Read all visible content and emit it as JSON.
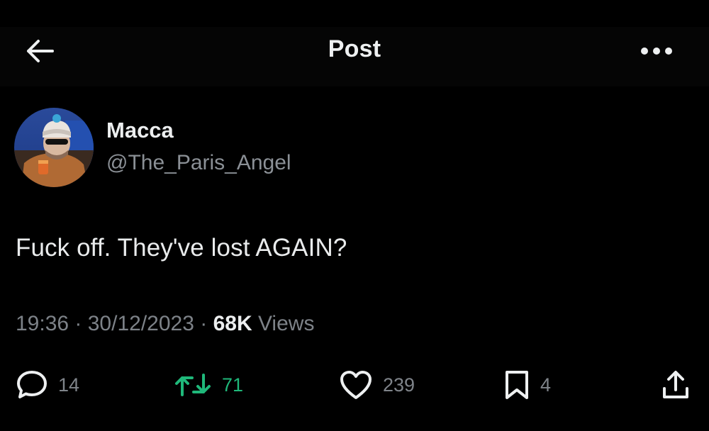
{
  "header": {
    "title": "Post"
  },
  "author": {
    "display_name": "Macca",
    "handle": "@The_Paris_Angel"
  },
  "post": {
    "text": "Fuck off.  They've lost AGAIN?",
    "time": "19:36",
    "date": "30/12/2023",
    "views_count": "68K",
    "views_label": "Views"
  },
  "actions": {
    "replies": "14",
    "reposts": "71",
    "likes": "239",
    "bookmarks": "4"
  },
  "colors": {
    "background": "#000000",
    "repost_active": "#1fb87a",
    "muted_text": "#7d8288"
  },
  "icons": {
    "back": "arrow-left-icon",
    "more": "more-horizontal-icon",
    "reply": "speech-bubble-icon",
    "repost": "repost-icon",
    "like": "heart-icon",
    "bookmark": "bookmark-icon",
    "share": "share-icon"
  }
}
